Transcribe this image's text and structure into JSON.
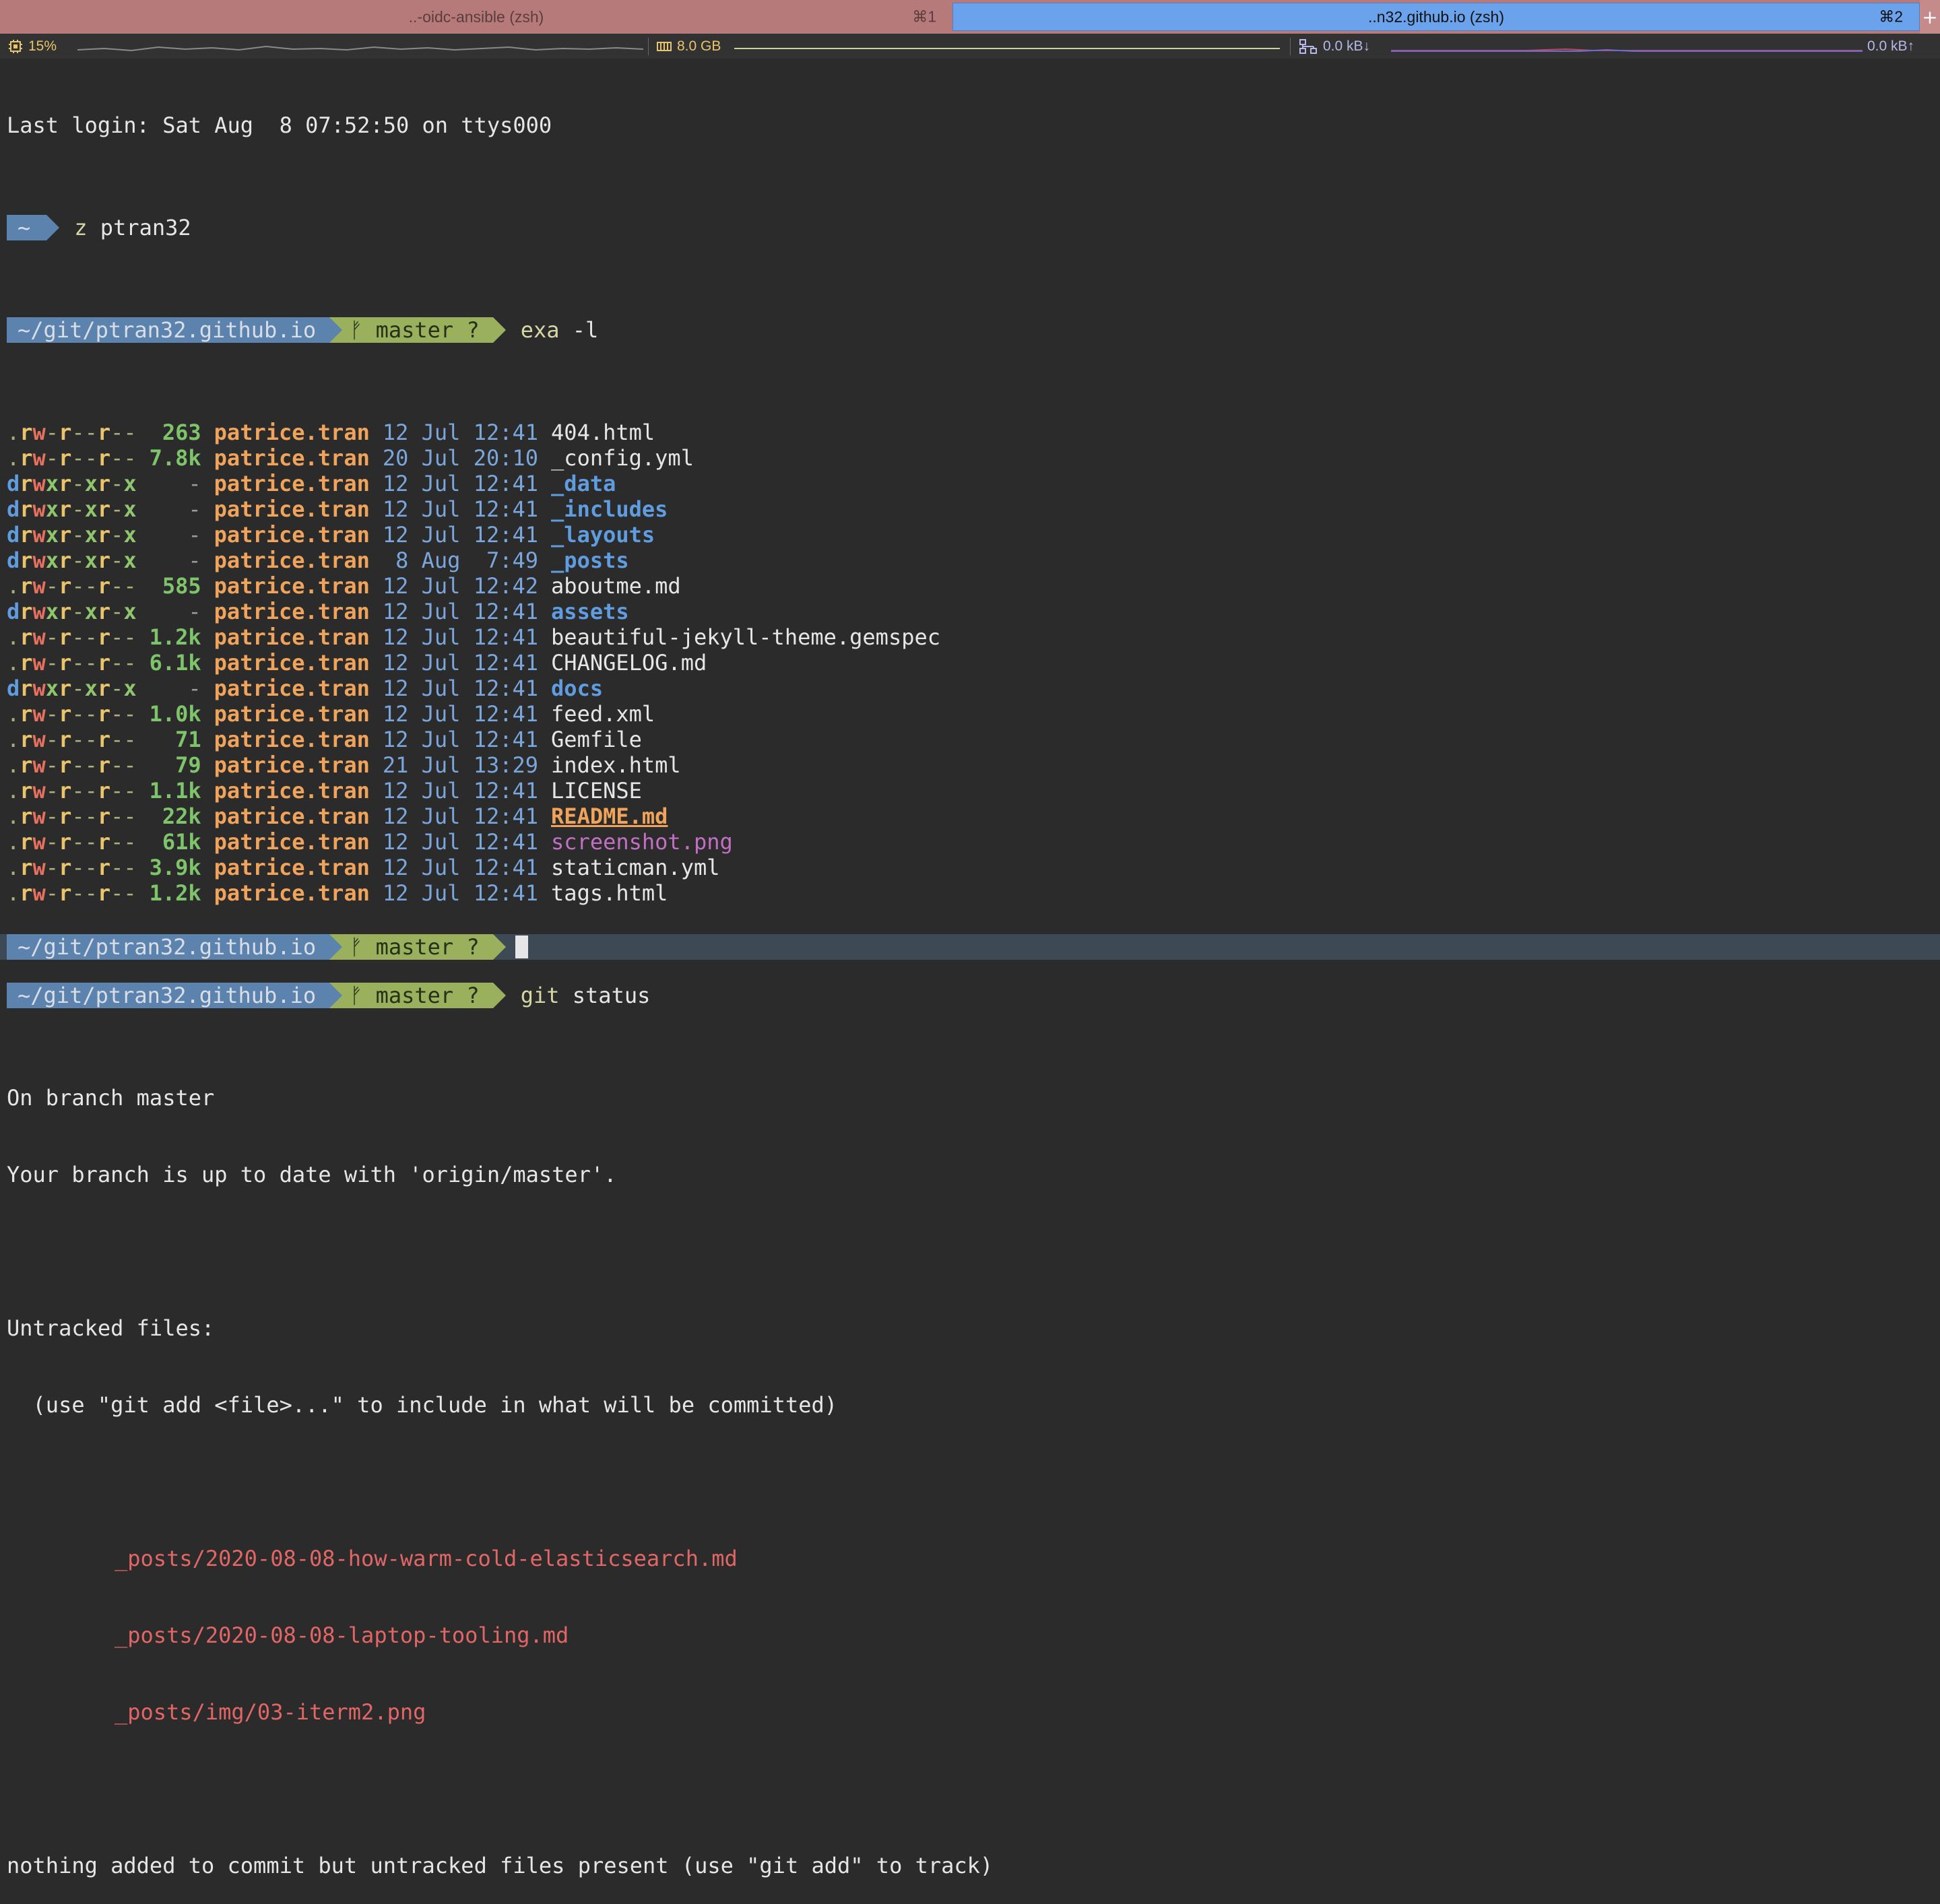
{
  "tabs": [
    {
      "title": "..-oidc-ansible (zsh)",
      "shortcut": "⌘1"
    },
    {
      "title": "..n32.github.io (zsh)",
      "shortcut": "⌘2"
    }
  ],
  "tab_add_label": "+",
  "status": {
    "cpu": "15%",
    "memory": "8.0 GB",
    "net_down": "0.0 kB↓",
    "net_up": "0.0 kB↑"
  },
  "terminal": {
    "last_login": "Last login: Sat Aug  8 07:52:50 on ttys000",
    "first_prompt_dir": "~",
    "first_cmd_name": "z",
    "first_cmd_arg": "ptran32",
    "prompt_dir": "~/git/ptran32.github.io",
    "prompt_git": "ᚠ master ?",
    "cmd1_name": "exa",
    "cmd1_arg": "-l",
    "files": [
      {
        "perm": ".rw-r--r--",
        "size": "263",
        "user": "patrice.tran",
        "date": "12 Jul 12:41",
        "name": "404.html",
        "kind": "file"
      },
      {
        "perm": ".rw-r--r--",
        "size": "7.8k",
        "user": "patrice.tran",
        "date": "20 Jul 20:10",
        "name": "_config.yml",
        "kind": "file"
      },
      {
        "perm": "drwxr-xr-x",
        "size": "-",
        "user": "patrice.tran",
        "date": "12 Jul 12:41",
        "name": "_data",
        "kind": "dir"
      },
      {
        "perm": "drwxr-xr-x",
        "size": "-",
        "user": "patrice.tran",
        "date": "12 Jul 12:41",
        "name": "_includes",
        "kind": "dir"
      },
      {
        "perm": "drwxr-xr-x",
        "size": "-",
        "user": "patrice.tran",
        "date": "12 Jul 12:41",
        "name": "_layouts",
        "kind": "dir"
      },
      {
        "perm": "drwxr-xr-x",
        "size": "-",
        "user": "patrice.tran",
        "date": " 8 Aug  7:49",
        "name": "_posts",
        "kind": "dir"
      },
      {
        "perm": ".rw-r--r--",
        "size": "585",
        "user": "patrice.tran",
        "date": "12 Jul 12:42",
        "name": "aboutme.md",
        "kind": "file"
      },
      {
        "perm": "drwxr-xr-x",
        "size": "-",
        "user": "patrice.tran",
        "date": "12 Jul 12:41",
        "name": "assets",
        "kind": "dir"
      },
      {
        "perm": ".rw-r--r--",
        "size": "1.2k",
        "user": "patrice.tran",
        "date": "12 Jul 12:41",
        "name": "beautiful-jekyll-theme.gemspec",
        "kind": "file"
      },
      {
        "perm": ".rw-r--r--",
        "size": "6.1k",
        "user": "patrice.tran",
        "date": "12 Jul 12:41",
        "name": "CHANGELOG.md",
        "kind": "file"
      },
      {
        "perm": "drwxr-xr-x",
        "size": "-",
        "user": "patrice.tran",
        "date": "12 Jul 12:41",
        "name": "docs",
        "kind": "dir"
      },
      {
        "perm": ".rw-r--r--",
        "size": "1.0k",
        "user": "patrice.tran",
        "date": "12 Jul 12:41",
        "name": "feed.xml",
        "kind": "file"
      },
      {
        "perm": ".rw-r--r--",
        "size": "71",
        "user": "patrice.tran",
        "date": "12 Jul 12:41",
        "name": "Gemfile",
        "kind": "file"
      },
      {
        "perm": ".rw-r--r--",
        "size": "79",
        "user": "patrice.tran",
        "date": "21 Jul 13:29",
        "name": "index.html",
        "kind": "file"
      },
      {
        "perm": ".rw-r--r--",
        "size": "1.1k",
        "user": "patrice.tran",
        "date": "12 Jul 12:41",
        "name": "LICENSE",
        "kind": "file"
      },
      {
        "perm": ".rw-r--r--",
        "size": "22k",
        "user": "patrice.tran",
        "date": "12 Jul 12:41",
        "name": "README.md",
        "kind": "readme"
      },
      {
        "perm": ".rw-r--r--",
        "size": "61k",
        "user": "patrice.tran",
        "date": "12 Jul 12:41",
        "name": "screenshot.png",
        "kind": "image"
      },
      {
        "perm": ".rw-r--r--",
        "size": "3.9k",
        "user": "patrice.tran",
        "date": "12 Jul 12:41",
        "name": "staticman.yml",
        "kind": "file"
      },
      {
        "perm": ".rw-r--r--",
        "size": "1.2k",
        "user": "patrice.tran",
        "date": "12 Jul 12:41",
        "name": "tags.html",
        "kind": "file"
      }
    ],
    "cmd2_name": "git",
    "cmd2_arg": "status",
    "git_output": {
      "line1": "On branch master",
      "line2": "Your branch is up to date with 'origin/master'.",
      "line3": "Untracked files:",
      "line4": "  (use \"git add <file>...\" to include in what will be committed)",
      "untracked": [
        "_posts/2020-08-08-how-warm-cold-elasticsearch.md",
        "_posts/2020-08-08-laptop-tooling.md",
        "_posts/img/03-iterm2.png"
      ],
      "line_final": "nothing added to commit but untracked files present (use \"git add\" to track)"
    }
  },
  "colors": {
    "background": "#2b2b2b",
    "tab_inactive": "#b77a7a",
    "tab_active": "#6aa2ec",
    "prompt_dir_bg": "#5b83ad",
    "prompt_git_bg": "#9bb05c",
    "user": "#f0a35a",
    "size": "#7ec46a",
    "directory": "#5f9de0",
    "untracked": "#e36666"
  }
}
